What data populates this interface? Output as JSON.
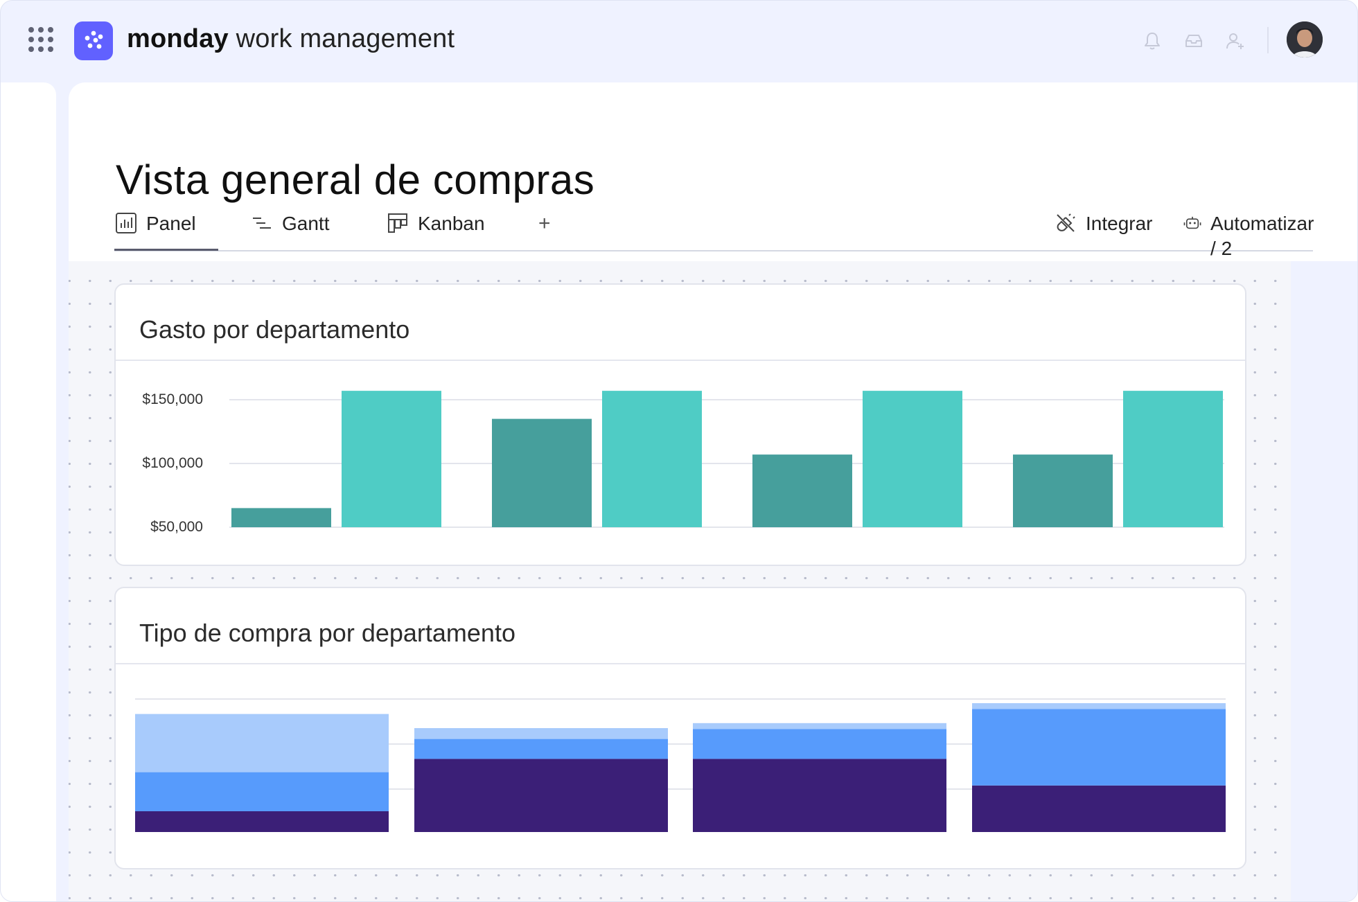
{
  "app": {
    "brand_bold": "monday",
    "brand_rest": " work management"
  },
  "header_icons": [
    "bell-icon",
    "inbox-icon",
    "invite-user-icon"
  ],
  "page": {
    "title": "Vista general de compras"
  },
  "tabs": [
    {
      "label": "Panel",
      "icon": "dashboard-icon",
      "active": true
    },
    {
      "label": "Gantt",
      "icon": "gantt-icon",
      "active": false
    },
    {
      "label": "Kanban",
      "icon": "kanban-icon",
      "active": false
    }
  ],
  "add_tab_label": "+",
  "actions": {
    "integrate_label": "Integrar",
    "automate_label": "Automatizar / 2"
  },
  "colors": {
    "brand": "#6161ff",
    "teal_dark": "#469f9c",
    "teal_light": "#4fccc5",
    "navy": "#3b1f77",
    "blue": "#579bfc",
    "light_blue": "#a8cbfc"
  },
  "chart_data": [
    {
      "type": "bar",
      "title": "Gasto por departamento",
      "ticks": [
        "$150,000",
        "$100,000",
        "$50,000"
      ],
      "ylim": [
        50000,
        150000
      ],
      "grid": true,
      "series": [
        {
          "values": [
            65000,
            135000,
            107000,
            107000
          ]
        },
        {
          "values": [
            157000,
            157000,
            157000,
            157000
          ]
        }
      ]
    },
    {
      "type": "bar",
      "stacked": true,
      "title": "Tipo de compra por departamento",
      "ylim": [
        0,
        160
      ],
      "grid": true,
      "series": [
        {
          "values": [
            25,
            88,
            88,
            56
          ]
        },
        {
          "values": [
            47,
            24,
            36,
            92
          ]
        },
        {
          "values": [
            70,
            13,
            7,
            7
          ]
        }
      ]
    }
  ]
}
